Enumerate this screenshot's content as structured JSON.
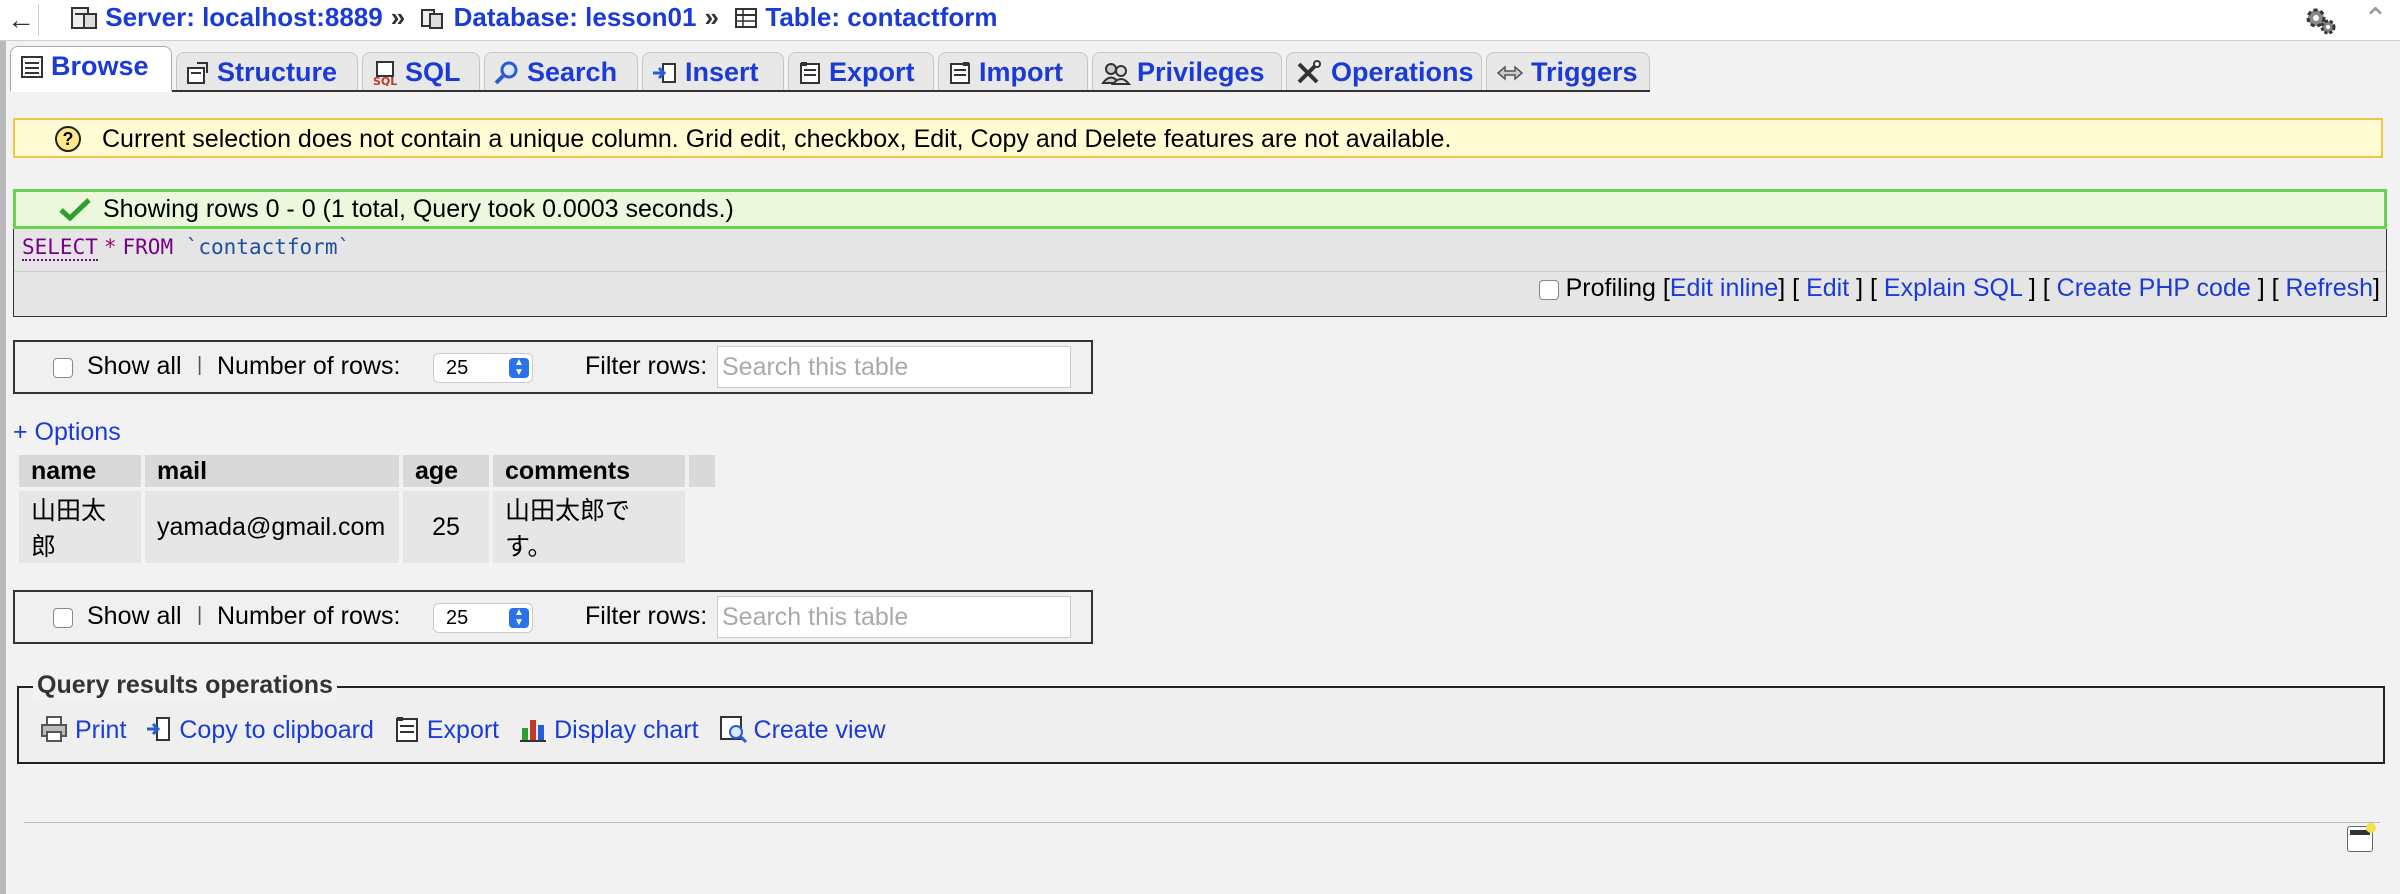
{
  "breadcrumb": {
    "server": "Server: localhost:8889",
    "database": "Database: lesson01",
    "table": "Table: contactform",
    "separator": "»"
  },
  "tabs": [
    {
      "label": "Browse",
      "icon": "browse-icon",
      "active": true
    },
    {
      "label": "Structure",
      "icon": "structure-icon"
    },
    {
      "label": "SQL",
      "icon": "sql-icon"
    },
    {
      "label": "Search",
      "icon": "search-icon"
    },
    {
      "label": "Insert",
      "icon": "insert-icon"
    },
    {
      "label": "Export",
      "icon": "export-icon"
    },
    {
      "label": "Import",
      "icon": "import-icon"
    },
    {
      "label": "Privileges",
      "icon": "privileges-icon"
    },
    {
      "label": "Operations",
      "icon": "operations-icon"
    },
    {
      "label": "Triggers",
      "icon": "triggers-icon"
    }
  ],
  "notice": "Current selection does not contain a unique column. Grid edit, checkbox, Edit, Copy and Delete features are not available.",
  "success": "Showing rows 0 - 0 (1 total, Query took 0.0003 seconds.)",
  "sql": {
    "select": "SELECT",
    "star": "*",
    "from": "FROM",
    "table": "`contactform`"
  },
  "sql_links": {
    "profiling": "Profiling",
    "edit_inline": "Edit inline",
    "edit": "Edit",
    "explain": "Explain SQL",
    "php": "Create PHP code",
    "refresh": "Refresh"
  },
  "nav": {
    "show_all": "Show all",
    "pipe": "|",
    "num_rows_label": "Number of rows:",
    "num_rows_value": "25",
    "filter_label": "Filter rows:",
    "filter_placeholder": "Search this table"
  },
  "options_link": "+ Options",
  "table": {
    "headers": [
      "name",
      "mail",
      "age",
      "comments"
    ],
    "rows": [
      [
        "山田太郎",
        "yamada@gmail.com",
        "25",
        "山田太郎です。"
      ]
    ]
  },
  "query_ops": {
    "legend": "Query results operations",
    "print": "Print",
    "copy": "Copy to clipboard",
    "export": "Export",
    "chart": "Display chart",
    "view": "Create view"
  },
  "colors": {
    "link": "#1a3bd6",
    "notice_bg": "#fffcd3",
    "notice_border": "#f0c64a",
    "success_bg": "#ebf8dc",
    "success_border": "#67d451"
  }
}
